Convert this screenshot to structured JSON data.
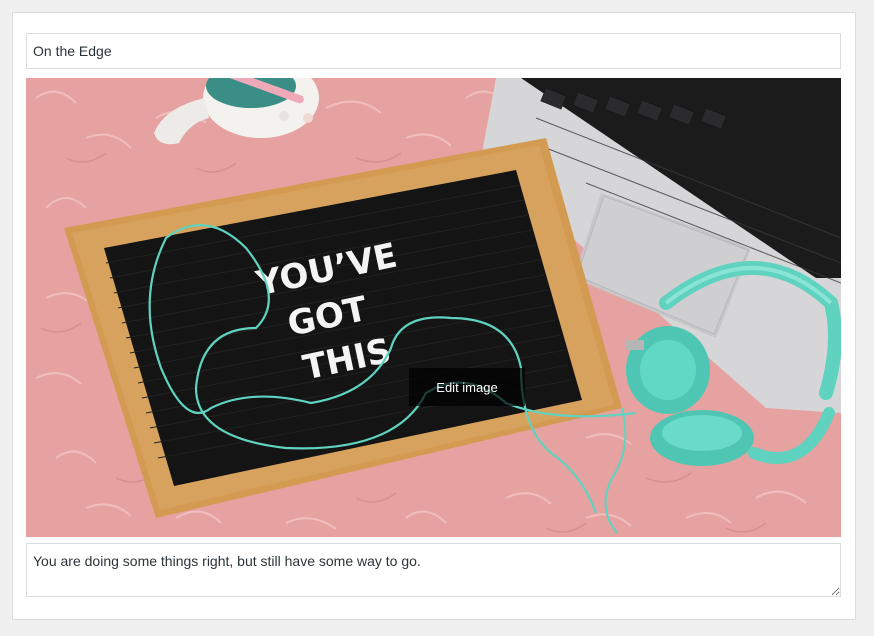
{
  "form": {
    "title_value": "On the Edge",
    "description_value": "You are doing some things right, but still have some way to go."
  },
  "image": {
    "icon": "letter-board-photo",
    "board_lines": [
      "YOU’VE",
      "GOT",
      "THIS"
    ],
    "edit_label": "Edit image"
  },
  "colors": {
    "page_bg": "#f0f0f1",
    "border": "#dcdcde",
    "rug": "#e7a3a2",
    "frame": "#d9a35a",
    "board": "#111111",
    "cable": "#5fd3c0",
    "laptop": "#d9d9db"
  }
}
